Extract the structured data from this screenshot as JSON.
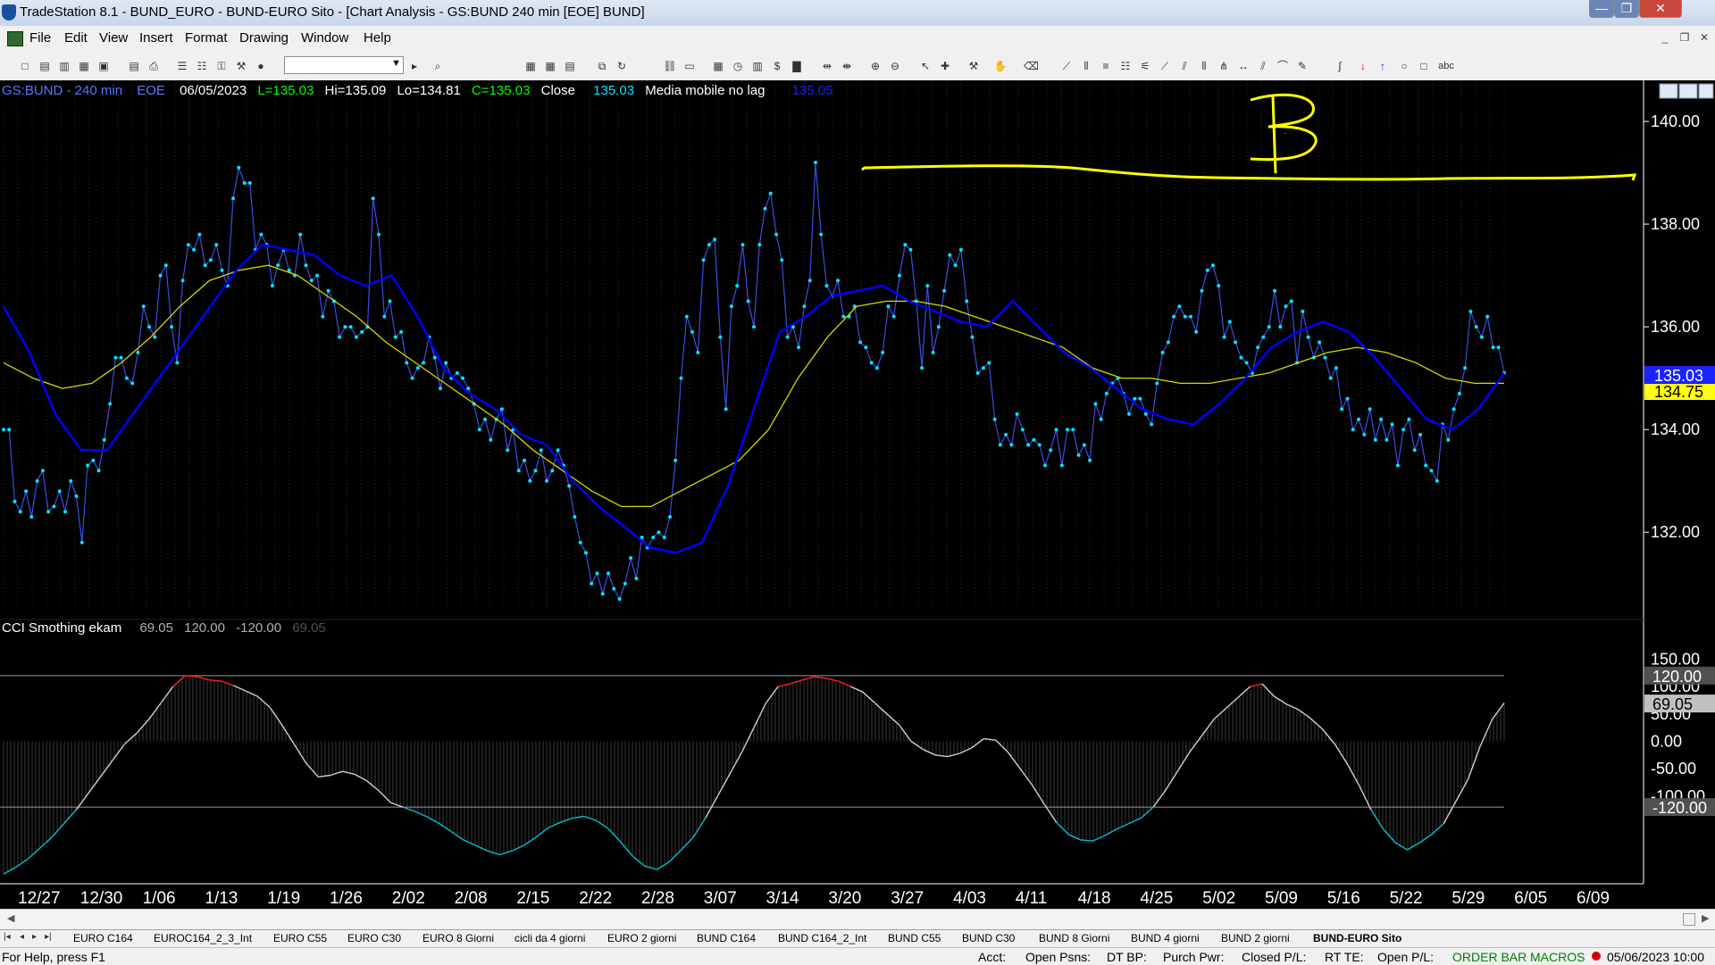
{
  "window": {
    "title": "TradeStation 8.1 - BUND_EURO - BUND-EURO Sito - [Chart Analysis - GS:BUND  240 min  [EOE] BUND]",
    "min_glyph": "—",
    "max_glyph": "❐",
    "close_glyph": "✕"
  },
  "menu": [
    "File",
    "Edit",
    "View",
    "Insert",
    "Format",
    "Drawing",
    "Window",
    "Help"
  ],
  "mdi": {
    "min": "_",
    "restore": "❐",
    "close": "✕"
  },
  "price_pane": {
    "symbol": "GS:BUND - 240 min",
    "session": "EOE",
    "date": "06/05/2023",
    "last": "L=135.03",
    "high": "Hi=135.09",
    "low": "Lo=134.81",
    "close": "C=135.03",
    "close_label": "Close",
    "close_value": "135.03",
    "ma_name": "Media mobile no lag",
    "ma_value": "135.05"
  },
  "cci_pane": {
    "name": "CCI Smothing ekam",
    "values": [
      "69.05",
      "120.00",
      "-120.00",
      "69.05"
    ]
  },
  "colors": {
    "background": "#000000",
    "price_line": "#3b4fe0",
    "price_dots": "#00e5ff",
    "ma_fast": "#0000ff",
    "ma_slow": "#d7d700",
    "annotation": "#ffff00",
    "cci_line": "#cfcfcf",
    "cci_overbought": "#ff2020",
    "cci_oversold": "#00c0d0",
    "marker_price": "#1a22ff",
    "marker_ma": "#ffff00"
  },
  "chart_data": [
    {
      "type": "line",
      "ylim": [
        130.3,
        140.8
      ],
      "y_ticks": [
        "140.00",
        "138.00",
        "136.00",
        "134.00",
        "132.00"
      ],
      "x_ticks": [
        "12/27",
        "12/30",
        "1/06",
        "1/13",
        "1/19",
        "1/26",
        "2/02",
        "2/08",
        "2/15",
        "2/22",
        "2/28",
        "3/07",
        "3/14",
        "3/20",
        "3/27",
        "4/03",
        "4/11",
        "4/18",
        "4/25",
        "5/02",
        "5/09",
        "5/16",
        "5/22",
        "5/29",
        "6/05",
        "6/09"
      ],
      "price_markers": [
        "135.03",
        "134.75"
      ],
      "annotation_letter": "B",
      "series": [
        {
          "values": [
            134.0,
            134.0,
            132.6,
            132.4,
            132.8,
            132.3,
            133.0,
            133.2,
            132.4,
            132.5,
            132.8,
            132.4,
            133.0,
            132.7,
            131.8,
            133.3,
            133.4,
            133.2,
            133.8,
            134.5,
            135.4,
            135.4,
            135.0,
            134.9,
            135.5,
            136.4,
            136.0,
            135.8,
            137.0,
            137.2,
            136.0,
            135.3,
            136.9,
            137.6,
            137.5,
            137.8,
            137.2,
            137.3,
            137.6,
            137.1,
            136.8,
            138.5,
            139.1,
            138.8,
            138.8,
            137.5,
            137.8,
            137.6,
            136.8,
            137.2,
            137.5,
            137.1,
            137.0,
            137.8,
            137.2,
            136.9,
            137.0,
            136.2,
            136.7,
            136.5,
            135.8,
            136.0,
            136.0,
            135.8,
            135.9,
            136.0,
            138.5,
            137.8,
            136.2,
            136.5,
            135.8,
            135.9,
            135.3,
            135.0,
            135.2,
            135.3,
            135.8,
            135.4,
            134.8,
            135.3,
            135.0,
            135.1,
            135.0,
            134.8,
            134.5,
            134.0,
            134.2,
            133.8,
            134.2,
            134.4,
            133.6,
            134.0,
            133.2,
            133.4,
            133.0,
            133.2,
            133.6,
            133.0,
            133.2,
            133.6,
            133.3,
            132.9,
            132.3,
            131.8,
            131.6,
            131.0,
            131.2,
            130.8,
            131.2,
            130.9,
            130.7,
            131.0,
            131.5,
            131.1,
            131.9,
            131.7,
            131.9,
            132.0,
            131.9,
            132.3,
            133.4,
            135.0,
            136.2,
            135.9,
            135.5,
            137.3,
            137.6,
            137.7,
            135.8,
            134.4,
            136.4,
            136.8,
            137.6,
            136.5,
            136.0,
            137.6,
            138.3,
            138.6,
            137.8,
            137.3,
            135.8,
            136.0,
            135.6,
            136.4,
            136.9,
            139.2,
            137.8,
            136.8,
            136.6,
            136.9,
            136.2,
            136.2,
            136.4,
            135.7,
            135.6,
            135.3,
            135.2,
            135.5,
            136.4,
            136.2,
            137.0,
            137.6,
            137.5,
            136.5,
            135.2,
            136.8,
            135.5,
            136.0,
            136.7,
            137.4,
            137.2,
            137.5,
            136.5,
            135.8,
            135.1,
            135.2,
            135.3,
            134.2,
            133.7,
            133.9,
            133.7,
            134.3,
            134.0,
            133.7,
            133.8,
            133.7,
            133.3,
            133.6,
            134.0,
            133.3,
            134.0,
            134.0,
            133.5,
            133.7,
            133.4,
            134.5,
            134.2,
            134.7,
            134.9,
            135.0,
            134.7,
            134.3,
            134.6,
            134.6,
            134.3,
            134.1,
            134.9,
            135.5,
            135.7,
            136.2,
            136.4,
            136.2,
            136.2,
            135.9,
            136.7,
            137.1,
            137.2,
            136.8,
            135.8,
            136.1,
            135.7,
            135.4,
            135.3,
            135.1,
            135.6,
            135.8,
            136.0,
            136.7,
            136.0,
            136.4,
            136.5,
            135.3,
            136.3,
            135.8,
            135.4,
            135.7,
            135.4,
            135.0,
            135.2,
            134.4,
            134.6,
            134.0,
            134.2,
            133.9,
            134.4,
            133.8,
            134.2,
            133.8,
            134.1,
            133.3,
            134.0,
            134.2,
            133.6,
            133.9,
            133.3,
            133.2,
            133.0,
            134.1,
            133.8,
            134.4,
            134.7,
            135.2,
            136.3,
            136.0,
            135.8,
            136.2,
            135.6,
            135.6,
            135.1
          ]
        },
        {
          "values": [
            136.4,
            135.5,
            134.3,
            133.6,
            133.6,
            134.3,
            135.0,
            135.7,
            136.4,
            137.1,
            137.6,
            137.5,
            137.4,
            137.0,
            136.8,
            137.0,
            136.2,
            135.2,
            134.7,
            134.4,
            133.9,
            133.7,
            133.0,
            132.5,
            132.1,
            131.7,
            131.6,
            131.8,
            132.9,
            134.4,
            135.9,
            136.2,
            136.6,
            136.7,
            136.8,
            136.5,
            136.3,
            136.1,
            136.0,
            136.5,
            136.0,
            135.5,
            135.2,
            134.8,
            134.4,
            134.2,
            134.1,
            134.5,
            135.0,
            135.6,
            135.9,
            136.1,
            135.9,
            135.4,
            134.8,
            134.2,
            134.0,
            134.4,
            135.1
          ]
        },
        {
          "values": [
            135.3,
            135.0,
            134.8,
            134.9,
            135.3,
            135.8,
            136.4,
            136.9,
            137.1,
            137.2,
            137.0,
            136.6,
            136.2,
            135.7,
            135.3,
            134.9,
            134.5,
            134.1,
            133.6,
            133.2,
            132.8,
            132.5,
            132.5,
            132.8,
            133.1,
            133.4,
            134.0,
            135.0,
            135.8,
            136.4,
            136.5,
            136.5,
            136.4,
            136.2,
            136.0,
            135.8,
            135.6,
            135.2,
            135.0,
            135.0,
            134.9,
            134.9,
            135.0,
            135.1,
            135.3,
            135.5,
            135.6,
            135.5,
            135.3,
            135.0,
            134.9,
            134.9
          ]
        }
      ]
    },
    {
      "type": "line",
      "ylim": [
        -260,
        180
      ],
      "y_ticks": [
        "150.00",
        "100.00",
        "50.00",
        "0.00",
        "-50.00",
        "-100.00"
      ],
      "levels": [
        "120.00",
        "-120.00",
        "69.05"
      ],
      "values": [
        -242,
        -230,
        -215,
        -195,
        -175,
        -150,
        -125,
        -95,
        -65,
        -35,
        -5,
        15,
        40,
        70,
        100,
        120,
        118,
        112,
        110,
        102,
        92,
        82,
        62,
        30,
        -5,
        -40,
        -65,
        -62,
        -55,
        -60,
        -72,
        -90,
        -112,
        -120,
        -128,
        -138,
        -150,
        -165,
        -180,
        -190,
        -200,
        -207,
        -200,
        -190,
        -175,
        -158,
        -148,
        -140,
        -137,
        -145,
        -160,
        -184,
        -210,
        -228,
        -234,
        -220,
        -198,
        -175,
        -140,
        -100,
        -60,
        -20,
        25,
        70,
        100,
        105,
        112,
        118,
        115,
        110,
        100,
        90,
        70,
        50,
        30,
        0,
        -15,
        -25,
        -28,
        -22,
        -12,
        5,
        2,
        -20,
        -50,
        -80,
        -115,
        -148,
        -170,
        -180,
        -182,
        -172,
        -160,
        -150,
        -140,
        -120,
        -90,
        -55,
        -20,
        10,
        40,
        60,
        80,
        100,
        105,
        82,
        68,
        58,
        42,
        22,
        -5,
        -40,
        -80,
        -125,
        -160,
        -185,
        -198,
        -185,
        -170,
        -150,
        -110,
        -70,
        -10,
        40,
        70
      ]
    }
  ],
  "tabs": [
    "EURO C164",
    "EUROC164_2_3_Int",
    "EURO C55",
    "EURO C30",
    "EURO 8 Giorni",
    "cicli da 4 giorni",
    "EURO 2 giorni",
    "BUND C164",
    "BUND C164_2_Int",
    "BUND C55",
    "BUND  C30",
    "BUND 8 Giorni",
    "BUND 4 giorni",
    "BUND 2 giorni",
    "BUND-EURO Sito"
  ],
  "active_tab": "BUND-EURO Sito",
  "tab_nav": [
    "|◂",
    "◂",
    "▸",
    "▸|"
  ],
  "status": {
    "help": "For Help, press F1",
    "acct": "Acct:",
    "open_psns": "Open Psns:",
    "dt_bp": "DT BP:",
    "purch_pwr": "Purch Pwr:",
    "closed_pl": "Closed P/L:",
    "rt_te": "RT TE:",
    "open_pl": "Open P/L:",
    "order_bar": "ORDER BAR",
    "macros": "MACROS",
    "datetime": "05/06/2023 10:00"
  }
}
